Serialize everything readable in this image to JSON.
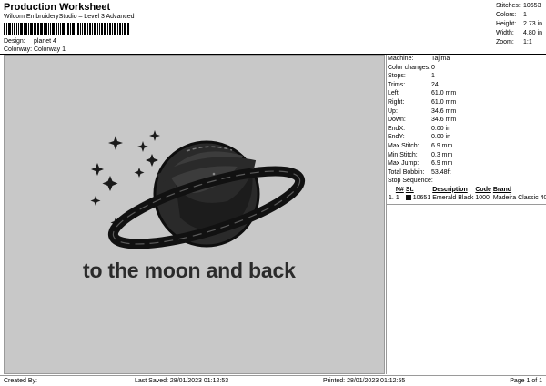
{
  "header": {
    "title": "Production Worksheet",
    "subtitle": "Wilcom EmbroideryStudio – Level 3 Advanced",
    "design_label": "Design:",
    "design_value": "planet 4",
    "colorway_label": "Colorway:",
    "colorway_value": "Colorway 1"
  },
  "stats": [
    {
      "label": "Stitches:",
      "value": "10653"
    },
    {
      "label": "Colors:",
      "value": "1"
    },
    {
      "label": "Height:",
      "value": "2.73 in"
    },
    {
      "label": "Width:",
      "value": "4.80 in"
    },
    {
      "label": "Zoom:",
      "value": "1:1"
    }
  ],
  "design": {
    "text": "to the moon and back",
    "thread_color": "#111111",
    "background_color": "#c8c8c8"
  },
  "info": [
    {
      "label": "Machine:",
      "value": "Tajima"
    },
    {
      "label": "Color changes:",
      "value": "0"
    },
    {
      "label": "Stops:",
      "value": "1"
    },
    {
      "label": "Trims:",
      "value": "24"
    },
    {
      "label": "Left:",
      "value": "61.0 mm"
    },
    {
      "label": "Right:",
      "value": "61.0 mm"
    },
    {
      "label": "Up:",
      "value": "34.6 mm"
    },
    {
      "label": "Down:",
      "value": "34.6 mm"
    },
    {
      "label": "EndX:",
      "value": "0.00 in"
    },
    {
      "label": "EndY:",
      "value": "0.00 in"
    },
    {
      "label": "Max Stitch:",
      "value": "6.9 mm"
    },
    {
      "label": "Min Stitch:",
      "value": "0.3 mm"
    },
    {
      "label": "Max Jump:",
      "value": "6.9 mm"
    },
    {
      "label": "Total Bobbin:",
      "value": "53.48ft"
    }
  ],
  "stop_sequence": {
    "title": "Stop Sequence:",
    "columns": [
      "N#",
      "St.",
      "Description",
      "Code",
      "Brand"
    ],
    "rows": [
      {
        "index": "1.",
        "n": "1",
        "stitches": "10651",
        "description": "Emerald Black",
        "code": "1000",
        "brand": "Madeira Classic 40"
      }
    ]
  },
  "footer": {
    "created_by": "Created By:",
    "last_saved": "Last Saved: 28/01/2023 01:12:53",
    "printed": "Printed: 28/01/2023 01:12:55",
    "page": "Page 1 of 1"
  }
}
